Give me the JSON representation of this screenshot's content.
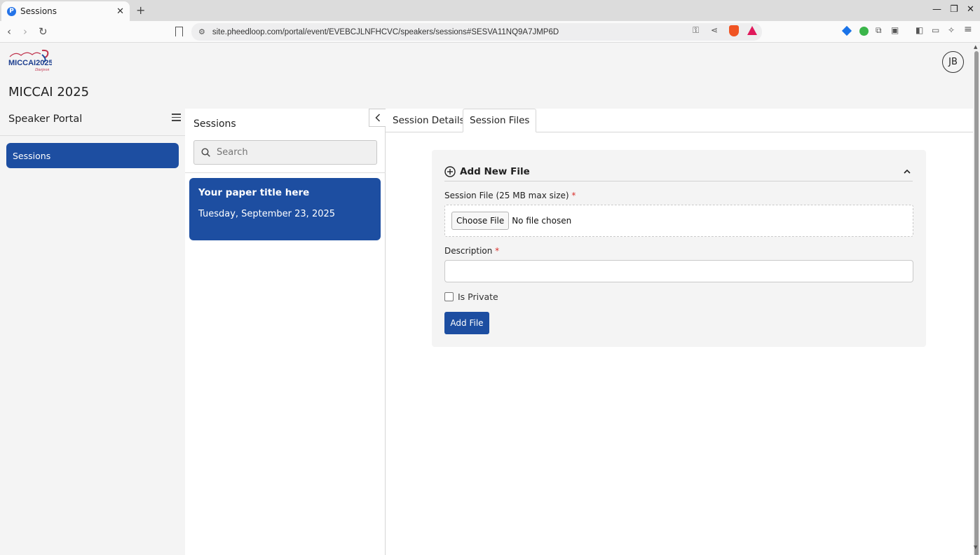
{
  "browser": {
    "tab_title": "Sessions",
    "url": "site.pheedloop.com/portal/event/EVEBCJLNFHCVC/speakers/sessions#SESVA11NQ9A7JMP6D"
  },
  "app": {
    "title": "MICCAI 2025",
    "logo_text": "MICCAI2025",
    "user_initials": "JB"
  },
  "sidebar": {
    "title": "Speaker Portal",
    "items": [
      {
        "label": "Sessions",
        "active": true
      }
    ]
  },
  "sessions_panel": {
    "title": "Sessions",
    "search_placeholder": "Search",
    "items": [
      {
        "title": "Your paper title here",
        "date": "Tuesday, September 23, 2025"
      }
    ]
  },
  "detail": {
    "tabs": [
      {
        "label": "Session Details",
        "active": false
      },
      {
        "label": "Session Files",
        "active": true
      }
    ],
    "add_file": {
      "heading": "Add New File",
      "file_label": "Session File (25 MB max size)",
      "required_mark": "*",
      "choose_button": "Choose File",
      "no_file_text": "No file chosen",
      "description_label": "Description",
      "description_value": "",
      "private_label": "Is Private",
      "private_checked": false,
      "submit_label": "Add File"
    }
  },
  "colors": {
    "primary": "#1d4ea1",
    "required": "#d9302c"
  }
}
